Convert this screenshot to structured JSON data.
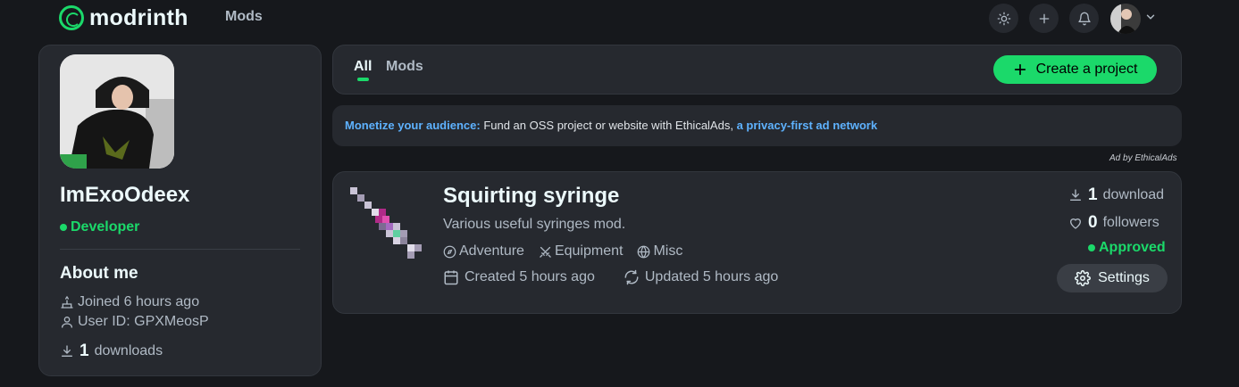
{
  "header": {
    "logo_text": "modrinth",
    "nav_mods": "Mods",
    "icons": [
      "sun-icon",
      "plus-icon",
      "bell-icon"
    ]
  },
  "profile": {
    "username": "ImExoOdeex",
    "role": "Developer",
    "about_title": "About me",
    "joined": "Joined 6 hours ago",
    "user_id": "User ID: GPXMeosP",
    "downloads_count": "1",
    "downloads_label": "downloads"
  },
  "tabs": {
    "all": "All",
    "mods": "Mods",
    "create_project": "Create a project"
  },
  "ad": {
    "lead": "Monetize your audience:",
    "body": " Fund an OSS project or website with EthicalAds, ",
    "link": "a privacy-first ad network",
    "attribution": "Ad by EthicalAds"
  },
  "project": {
    "title": "Squirting syringe",
    "description": "Various useful syringes mod.",
    "tags": [
      "Adventure",
      "Equipment",
      "Misc"
    ],
    "created": "Created 5 hours ago",
    "updated": "Updated 5 hours ago",
    "downloads_count": "1",
    "downloads_label": "download",
    "followers_count": "0",
    "followers_label": "followers",
    "status": "Approved",
    "settings_label": "Settings"
  },
  "colors": {
    "background": "#16181c",
    "card": "#26292f",
    "brand_green": "#1bd96a",
    "link_blue": "#5eb2ff"
  }
}
